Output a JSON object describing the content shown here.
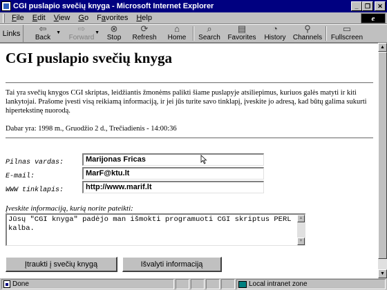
{
  "window": {
    "title": "CGI puslapio svečių knyga - Microsoft Internet Explorer",
    "buttons": {
      "minimize": "_",
      "maximize": "❐",
      "close": "✕"
    }
  },
  "menu": {
    "items": [
      {
        "accel": "F",
        "rest": "ile"
      },
      {
        "accel": "E",
        "rest": "dit"
      },
      {
        "accel": "V",
        "rest": "iew"
      },
      {
        "accel": "G",
        "rest": "o"
      },
      {
        "pre": "F",
        "accel": "a",
        "rest": "vorites"
      },
      {
        "accel": "H",
        "rest": "elp"
      }
    ]
  },
  "toolbar": {
    "links_label": "Links",
    "buttons": [
      {
        "label": "Back",
        "icon": "arrow-left-icon",
        "glyph": "⇦",
        "enabled": true,
        "dropdown": true
      },
      {
        "label": "Forward",
        "icon": "arrow-right-icon",
        "glyph": "⇨",
        "enabled": false,
        "dropdown": true
      },
      {
        "label": "Stop",
        "icon": "stop-icon",
        "glyph": "⊗",
        "enabled": true
      },
      {
        "label": "Refresh",
        "icon": "refresh-icon",
        "glyph": "⟳",
        "enabled": true
      },
      {
        "label": "Home",
        "icon": "home-icon",
        "glyph": "⌂",
        "enabled": true
      },
      {
        "label": "Search",
        "icon": "search-icon",
        "glyph": "⌕",
        "enabled": true
      },
      {
        "label": "Favorites",
        "icon": "favorites-icon",
        "glyph": "▤",
        "enabled": true
      },
      {
        "label": "History",
        "icon": "history-icon",
        "glyph": "◔",
        "enabled": true
      },
      {
        "label": "Channels",
        "icon": "channels-icon",
        "glyph": "⚲",
        "enabled": true
      },
      {
        "label": "Fullscreen",
        "icon": "fullscreen-icon",
        "glyph": "▭",
        "enabled": true
      }
    ]
  },
  "page": {
    "title": "CGI puslapio svečių knyga",
    "intro": "Tai yra svečių knygos CGI skriptas, leidžiantis žmonėms palikti šiame puslapyje atsiliepimus, kuriuos galės matyti ir kiti lankytojai. Prašome įvesti visą reikiamą informaciją, ir jei jūs turite savo tinklapį, įveskite jo adresą, kad būtų galima sukurti hipertekstinę nuorodą.",
    "date_line": "Dabar yra: 1998 m., Gruodžio 2 d., Trečiadienis - 14:00:36",
    "form": {
      "name_label": "Pilnas vardas:",
      "name_value": "Marijonas Fricas",
      "email_label": "E-mail:",
      "email_value": "MarF@ktu.lt",
      "web_label": "WWW tinklapis:",
      "web_value": "http://www.marif.lt",
      "comment_label": "Įveskite informaciją, kurią norite pateikti:",
      "comment_value": "Jūsų \"CGI knyga\" padėjo man išmokti programuoti CGI skriptus PERL kalba.",
      "submit_label": "Įtraukti į svečių knygą",
      "reset_label": "Išvalyti informaciją"
    }
  },
  "status": {
    "text": "Done",
    "zone": "Local intranet zone"
  }
}
